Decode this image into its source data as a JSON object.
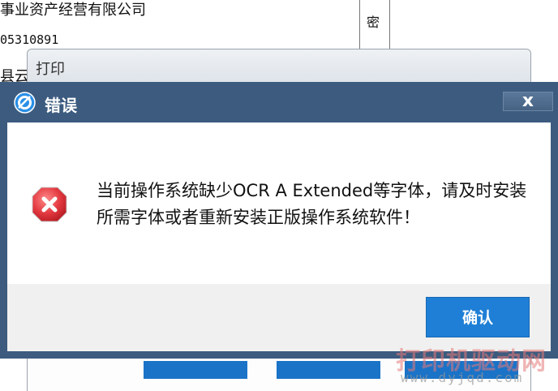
{
  "background_doc": {
    "line1": "事业资产经营有限公司",
    "line2": "05310891",
    "line3": "县云",
    "cell": "密"
  },
  "print_dialog": {
    "title": "打印"
  },
  "error_dialog": {
    "title": "错误",
    "close_label": "x",
    "message": "当前操作系统缺少OCR A Extended等字体，请及时安装所需字体或者重新安装正版操作系统软件！",
    "ok_label": "确认",
    "accent_color": "#1f7fd6",
    "titlebar_color": "#3c5b7f",
    "error_icon": "error-x-icon",
    "app_icon": "app-logo-icon"
  },
  "watermark": {
    "text": "打印机驱动网",
    "url": "www.dyjqd.com"
  }
}
